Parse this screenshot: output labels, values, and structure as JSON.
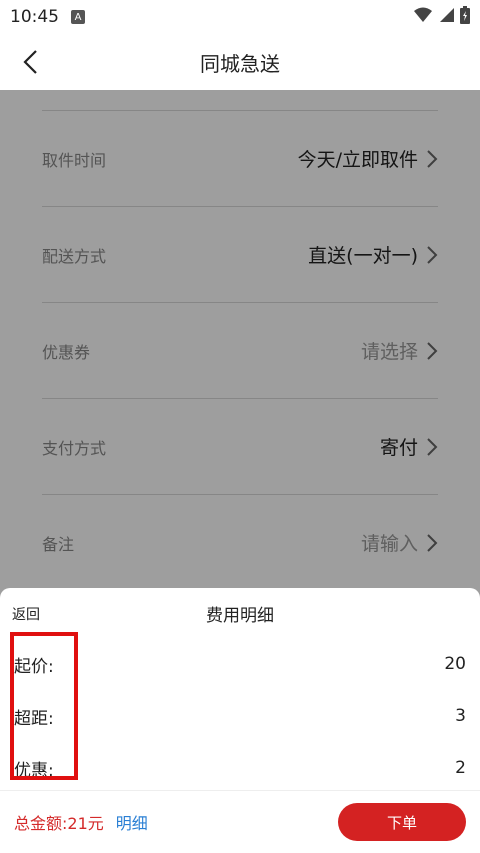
{
  "status_bar": {
    "time": "10:45",
    "notif_icon_letter": "A"
  },
  "nav": {
    "title": "同城急送"
  },
  "form": {
    "rows": [
      {
        "label": "取件时间",
        "value": "今天/立即取件",
        "placeholder": false
      },
      {
        "label": "配送方式",
        "value": "直送(一对一)",
        "placeholder": false
      },
      {
        "label": "优惠券",
        "value": "请选择",
        "placeholder": true
      },
      {
        "label": "支付方式",
        "value": "寄付",
        "placeholder": false
      },
      {
        "label": "备注",
        "value": "请输入",
        "placeholder": true
      }
    ]
  },
  "fee_sheet": {
    "back_label": "返回",
    "title": "费用明细",
    "items": [
      {
        "label": "起价:",
        "value": "20"
      },
      {
        "label": "超距:",
        "value": "3"
      },
      {
        "label": "优惠:",
        "value": "2"
      }
    ]
  },
  "bottom": {
    "total_text": "总金额:21元",
    "detail_link": "明细",
    "order_button": "下单"
  },
  "colors": {
    "accent_red": "#d42222",
    "link_blue": "#2a7fd4",
    "highlight_red": "#e01010"
  }
}
